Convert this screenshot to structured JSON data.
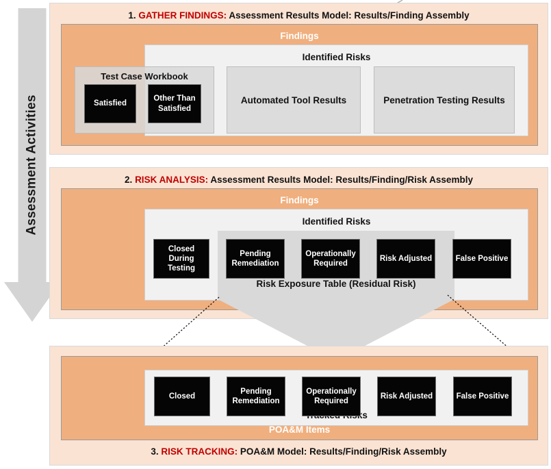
{
  "diagram": {
    "side_arrow": {
      "label": "Assessment Activities",
      "icon": "down-arrow-icon",
      "color": "#D4D4D4"
    },
    "colors": {
      "stage_background": "#FAE3D3",
      "findings_background": "#F0AF7E",
      "risks_background": "#F1F1F1",
      "gray_box": "#DCDCDC",
      "black_box": "#050505",
      "highlight_text": "#C00000",
      "chevron": "#D9D9D9"
    },
    "stages": [
      {
        "number": "1.",
        "highlight": "GATHER FINDINGS:",
        "title": " Assessment Results Model: Results/Finding Assembly",
        "findings_label": "Findings",
        "risks_label": "Identified Risks",
        "workbook": {
          "label": "Test Case Workbook",
          "items": [
            {
              "label": "Satisfied"
            },
            {
              "label": "Other Than\nSatisfied",
              "line1": "Other Than",
              "line2": "Satisfied"
            }
          ]
        },
        "result_boxes": [
          {
            "label": "Automated Tool Results"
          },
          {
            "label": "Penetration Testing Results"
          }
        ]
      },
      {
        "number": "2.",
        "highlight": "RISK ANALYSIS:",
        "title": " Assessment Results Model: Results/Finding/Risk Assembly",
        "findings_label": "Findings",
        "risks_label": "Identified Risks",
        "chevron_label": "Risk Exposure Table (Residual Risk)",
        "risk_boxes": [
          {
            "line1": "Closed During",
            "line2": "Testing"
          },
          {
            "line1": "Pending",
            "line2": "Remediation"
          },
          {
            "line1": "Operationally",
            "line2": "Required"
          },
          {
            "line1": "Risk Adjusted",
            "line2": ""
          },
          {
            "line1": "False Positive",
            "line2": ""
          }
        ]
      },
      {
        "number": "3.",
        "highlight": "RISK TRACKING:",
        "title": " POA&M Model: Results/Finding/Risk Assembly",
        "findings_label": "POA&M Items",
        "risks_label": "Tracked Risks",
        "risk_boxes": [
          {
            "line1": "Closed",
            "line2": ""
          },
          {
            "line1": "Pending",
            "line2": "Remediation"
          },
          {
            "line1": "Operationally",
            "line2": "Required"
          },
          {
            "line1": "Risk Adjusted",
            "line2": ""
          },
          {
            "line1": "False Positive",
            "line2": ""
          }
        ]
      }
    ]
  }
}
